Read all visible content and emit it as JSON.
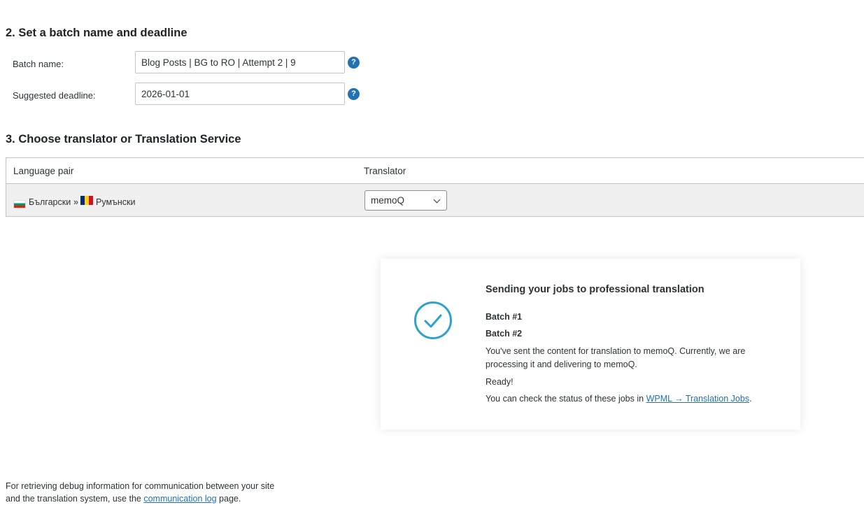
{
  "section2": {
    "heading": "2. Set a batch name and deadline",
    "batch_name_label": "Batch name:",
    "batch_name_value": "Blog Posts | BG to RO | Attempt 2 | 9",
    "deadline_label": "Suggested deadline:",
    "deadline_value": "2026-01-01",
    "help_glyph": "?"
  },
  "section3": {
    "heading": "3. Choose translator or Translation Service",
    "columns": [
      "Language pair",
      "Translator"
    ],
    "row": {
      "source_lang": "Български",
      "separator": "»",
      "target_lang": "Румънски",
      "translator_selected": "memoQ"
    }
  },
  "card": {
    "title": "Sending your jobs to professional translation",
    "batch1": "Batch #1",
    "batch2": "Batch #2",
    "message": "You've sent the content for translation to memoQ. Currently, we are processing it and delivering to memoQ.",
    "ready": "Ready!",
    "status_prefix": "You can check the status of these jobs in ",
    "status_link": "WPML → Translation Jobs",
    "status_suffix": ".",
    "icon": "check-circle-icon",
    "accent_color": "#2ea2cc"
  },
  "footer": {
    "prefix": "For retrieving debug information for communication between your site and the translation system, use the ",
    "link": "communication log",
    "suffix": " page."
  },
  "colors": {
    "link": "#2271b1",
    "help_icon": "#2271b1",
    "row_bg": "#f0f0f1"
  }
}
